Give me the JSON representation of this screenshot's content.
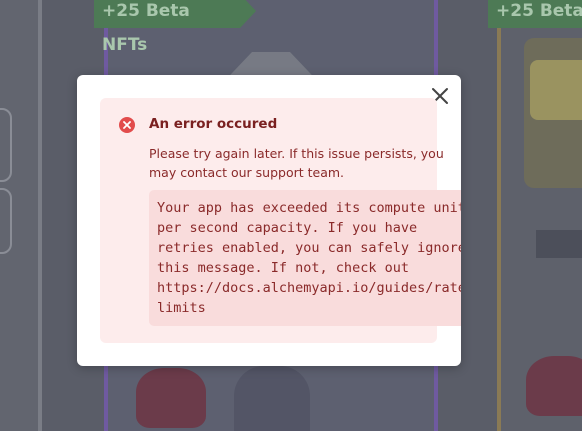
{
  "background": {
    "ribbon_left": "+25 Beta NFTs",
    "ribbon_right": "+25 Beta"
  },
  "modal": {
    "close_icon": "close-icon",
    "error": {
      "icon": "error-circle-icon",
      "title": "An error occured",
      "message": "Please try again later. If this issue persists, you may contact our support team.",
      "details": "Your app has exceeded its compute units\nper second capacity. If you have\nretries enabled, you can safely ignore\nthis message. If not, check out\nhttps://docs.alchemyapi.io/guides/rate-\nlimits"
    }
  },
  "colors": {
    "error_red": "#e24c4c",
    "alert_bg": "#fdecec",
    "overlay": "#5a5d68"
  }
}
